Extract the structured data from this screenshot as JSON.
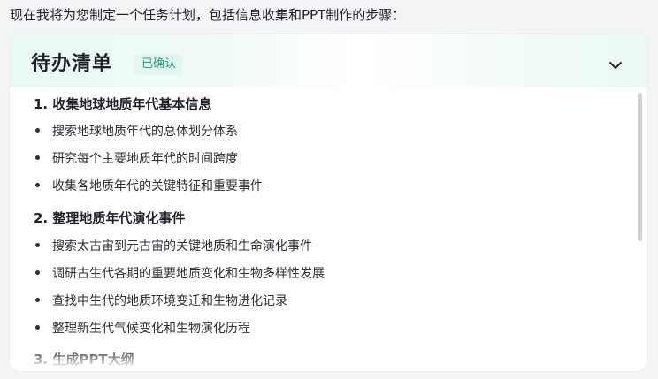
{
  "message": {
    "intro": "现在我将为您制定一个任务计划，包括信息收集和PPT制作的步骤："
  },
  "todo_card": {
    "title": "待办清单",
    "status": "已确认",
    "collapse_icon": "chevron-down-icon",
    "sections": [
      {
        "title": "1. 收集地球地质年代基本信息",
        "tasks": [
          "搜索地球地质年代的总体划分体系",
          "研究每个主要地质年代的时间跨度",
          "收集各地质年代的关键特征和重要事件"
        ]
      },
      {
        "title": "2. 整理地质年代演化事件",
        "tasks": [
          "搜索太古宙到元古宙的关键地质和生命演化事件",
          "调研古生代各期的重要地质变化和生物多样性发展",
          "查找中生代的地质环境变迁和生物进化记录",
          "整理新生代气候变化和生物演化历程"
        ]
      },
      {
        "title": "3. 生成PPT大纲",
        "tasks": []
      }
    ]
  },
  "colors": {
    "status_text": "#1aa97a",
    "status_bg": "#e4f6ef",
    "scrollbar": "#cfd2d6"
  }
}
